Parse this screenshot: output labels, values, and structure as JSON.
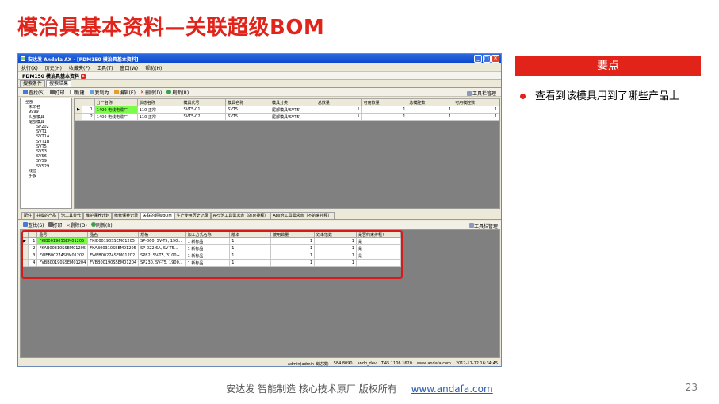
{
  "slide": {
    "title": "模治具基本资料—关联超级BOM",
    "points_header": "要点",
    "bullet": "查看到该模具用到了哪些产品上",
    "footer_text": "安达发   智能制造 核心技术原厂    版权所有",
    "footer_link": "www.andafa.com",
    "page_number": "23"
  },
  "app": {
    "window_title": "安达发 Andafa AX - [PDM150 模治具基本资料]",
    "menu": [
      "执行(X)",
      "历史(H)",
      "收藏夹(F)",
      "工具(T)",
      "窗口(W)",
      "帮助(H)"
    ],
    "doc_tab": "PDM150 模治具基本资料",
    "doc_tab_close": "x",
    "subtabs": [
      "搜索条件",
      "搜索结果"
    ],
    "toolbar": [
      "查找(S)",
      "打印",
      "新建",
      "复制为",
      "编辑(E)",
      "删除(D)",
      "刷新(R)"
    ],
    "toolbar_right": "工具栏管理",
    "tree": [
      "全部",
      "未命名",
      "9999",
      "头部模具",
      "尾部模具",
      "SP202",
      "SVT1",
      "SVT1A",
      "SVT1B",
      "SVT5",
      "SVS3",
      "SVS6",
      "SVS9",
      "SVS29",
      "线位",
      "手板"
    ],
    "grid1": {
      "columns": [
        "分厂名称",
        "状态名称",
        "模具代号",
        "模具名称",
        "模具分类",
        "总数量",
        "可用数量",
        "总模腔数",
        "可用模腔数"
      ],
      "rows": [
        {
          "idx": "1",
          "factory": "1400 电线电缆厂",
          "status": "110 正常",
          "code": "SVT5-01",
          "name": "SVT5",
          "category": "尾部模具\\SVT5\\",
          "total": "1",
          "avail": "1",
          "cav_total": "1",
          "cav_avail": "1"
        },
        {
          "idx": "2",
          "factory": "1400 电线电缆厂",
          "status": "110 正常",
          "code": "SVT5-02",
          "name": "SVT5",
          "category": "尾部模具\\SVT5\\",
          "total": "1",
          "avail": "1",
          "cav_total": "1",
          "cav_avail": "1"
        }
      ]
    },
    "lower_tabs": [
      "配件",
      "共模的产品",
      "治工具替代",
      "维护保养计划",
      "维修保养记录",
      "关联的超级BOM",
      "生产使用历史记录",
      "APS治工具需求表（的束排程）",
      "Aps治工具需求表（不的束排程）"
    ],
    "toolbar2": [
      "查找(S)",
      "打印",
      "删除(D)",
      "刷新(R)"
    ],
    "toolbar2_right": "工具栏管理",
    "grid2": {
      "columns": [
        "品号",
        "品名",
        "规格",
        "加工方式名称",
        "版本",
        "使用数量",
        "效率倍数",
        "是否约束排程?"
      ],
      "rows": [
        {
          "idx": "1",
          "pn": "FKIB00190SSEM01205",
          "name": "FKIB00190SSEM01205",
          "spec": "SP-060, SV-T5, 190...",
          "method": "1 新标品",
          "ver": "1",
          "qty": "1",
          "eff": "1",
          "constraint": "是"
        },
        {
          "idx": "2",
          "pn": "FKAB00310SSEM01205",
          "name": "FKAB00310SSEM01205",
          "spec": "SP-022 6A, SV-T5...",
          "method": "1 新标品",
          "ver": "1",
          "qty": "1",
          "eff": "1",
          "constraint": "是"
        },
        {
          "idx": "3",
          "pn": "FWEB00274SEM01202",
          "name": "FWEB00274SEM01202",
          "spec": "SP82, SV-T5, 3100+...",
          "method": "1 新标品",
          "ver": "1",
          "qty": "1",
          "eff": "1",
          "constraint": "是"
        },
        {
          "idx": "4",
          "pn": "FVBB00190SSEM01204",
          "name": "FVBB00190SSEM01204",
          "spec": "SP230, SV-T5, 1900...",
          "method": "1 新标品",
          "ver": "1",
          "qty": "1",
          "eff": "1",
          "constraint": ""
        }
      ]
    },
    "status": [
      "admin(admin 安达发)",
      "584.8090",
      "andb_dev",
      "T.45.1106.1620",
      "www.andafa.com",
      "2012-11-12 16:34:45"
    ]
  },
  "colors": {
    "accent": "#e2231a",
    "selected_cell": "#7cfc4a",
    "link": "#2a5db0"
  }
}
